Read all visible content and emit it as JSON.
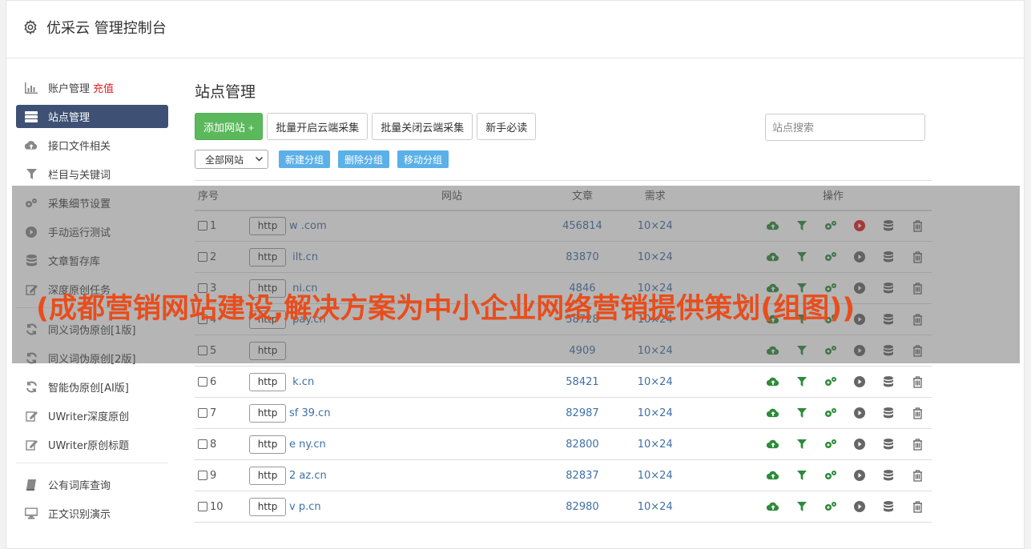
{
  "header": {
    "title": "优采云 管理控制台"
  },
  "sidebar": {
    "items": [
      {
        "label": "账户管理",
        "extra": "充值",
        "icon": "bar-chart-icon"
      },
      {
        "label": "站点管理",
        "icon": "server-icon",
        "active": true
      },
      {
        "label": "接口文件相关",
        "icon": "cloud-upload-icon"
      },
      {
        "label": "栏目与关键词",
        "icon": "filter-icon"
      },
      {
        "label": "采集细节设置",
        "icon": "gears-icon"
      },
      {
        "label": "手动运行测试",
        "icon": "play-circle-icon"
      },
      {
        "label": "文章暂存库",
        "icon": "database-icon"
      },
      {
        "label": "深度原创任务",
        "icon": "edit-icon"
      }
    ],
    "items2": [
      {
        "label": "同义词伪原创[1版]",
        "icon": "refresh-icon"
      },
      {
        "label": "同义词伪原创[2版]",
        "icon": "refresh-icon"
      },
      {
        "label": "智能伪原创[AI版]",
        "icon": "refresh-icon"
      },
      {
        "label": "UWriter深度原创",
        "icon": "edit-icon"
      },
      {
        "label": "UWriter原创标题",
        "icon": "edit-icon"
      }
    ],
    "items3": [
      {
        "label": "公有词库查询",
        "icon": "book-icon"
      },
      {
        "label": "正文识别演示",
        "icon": "monitor-icon"
      }
    ]
  },
  "main": {
    "title": "站点管理",
    "toolbar": {
      "add": "添加网站 +",
      "batch_open": "批量开启云端采集",
      "batch_close": "批量关闭云端采集",
      "guide": "新手必读",
      "search_placeholder": "站点搜索"
    },
    "subbar": {
      "select_value": "全部网站",
      "new_group": "新建分组",
      "delete_group": "删除分组",
      "move_group": "移动分组"
    },
    "table": {
      "headers": {
        "no": "序号",
        "site": "网站",
        "articles": "文章",
        "demand": "需求",
        "ops": "操作"
      },
      "rows": [
        {
          "no": "1",
          "http": "http",
          "domain": "w             .com",
          "articles": "456814",
          "demand": "10×24",
          "active": true
        },
        {
          "no": "2",
          "http": "http",
          "domain": "      ilt.cn",
          "articles": "83870",
          "demand": "10×24",
          "active": false
        },
        {
          "no": "3",
          "http": "http",
          "domain": "       ni.cn",
          "articles": "4846",
          "demand": "10×24",
          "active": false
        },
        {
          "no": "4",
          "http": "http",
          "domain": "       pay.cn",
          "articles": "58728",
          "demand": "10×24",
          "active": false
        },
        {
          "no": "5",
          "http": "http",
          "domain": "",
          "articles": "4909",
          "demand": "10×24",
          "active": false
        },
        {
          "no": "6",
          "http": "http",
          "domain": "      k.cn",
          "articles": "58421",
          "demand": "10×24",
          "active": false
        },
        {
          "no": "7",
          "http": "http",
          "domain": "sf   39.cn",
          "articles": "82987",
          "demand": "10×24",
          "active": false
        },
        {
          "no": "8",
          "http": "http",
          "domain": "e      ny.cn",
          "articles": "82800",
          "demand": "10×24",
          "active": false
        },
        {
          "no": "9",
          "http": "http",
          "domain": "2      az.cn",
          "articles": "82837",
          "demand": "10×24",
          "active": false
        },
        {
          "no": "10",
          "http": "http",
          "domain": "v      p.cn",
          "articles": "82980",
          "demand": "10×24",
          "active": false
        }
      ]
    }
  },
  "overlay": {
    "headline": "(成都营销网站建设,解决方案为中小企业网络营销提供策划(组图))"
  },
  "colors": {
    "active_nav": "#3e5174",
    "green": "#5cb85c",
    "blue_btn": "#5bb0e8",
    "link": "#3f6fa5",
    "headline": "#e84d1c",
    "play_active": "#e02020"
  }
}
